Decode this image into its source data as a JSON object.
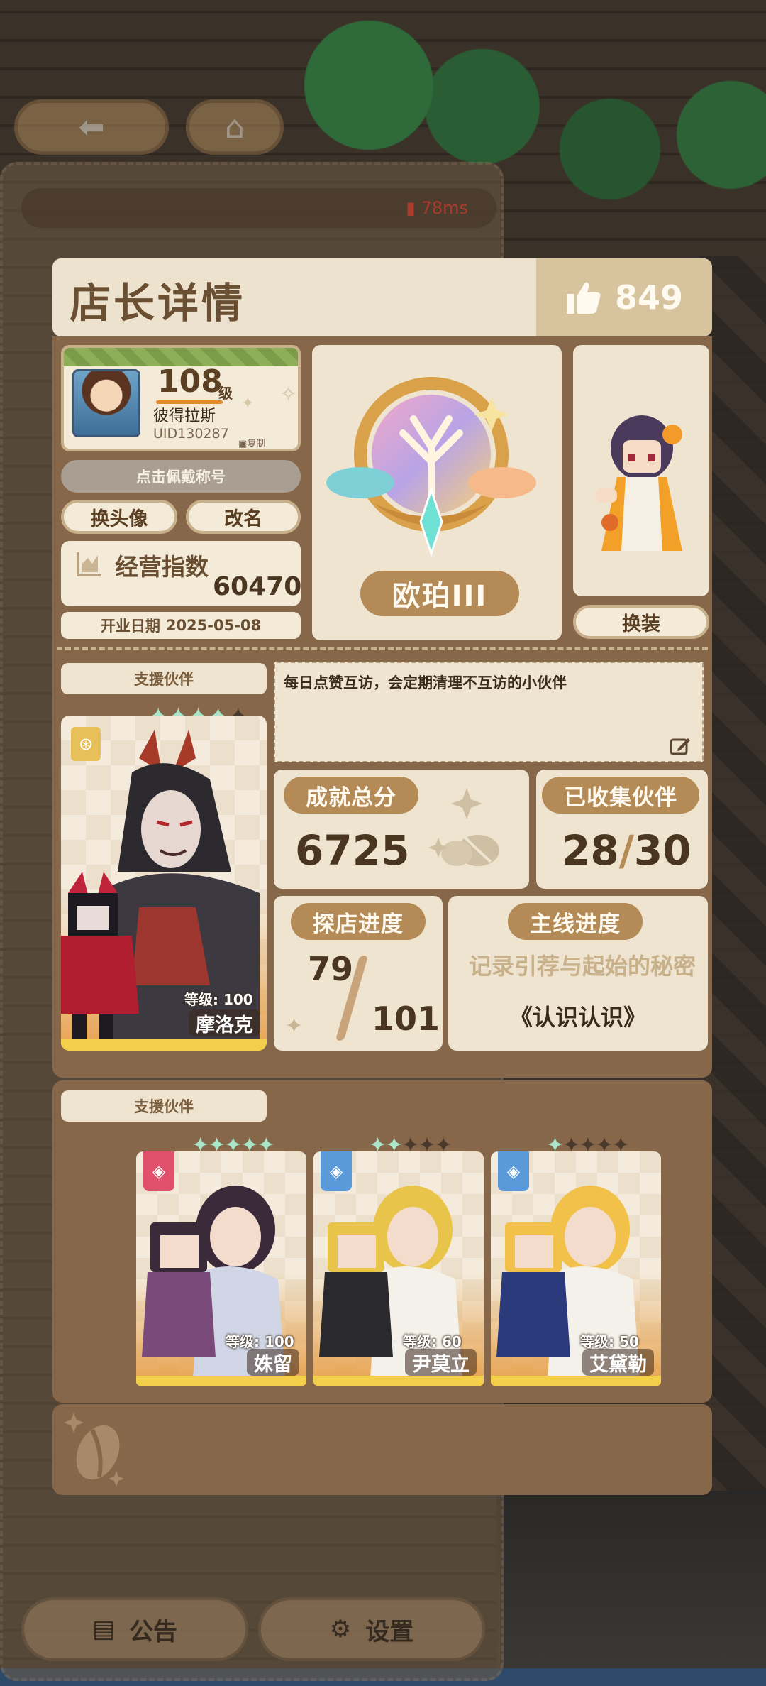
{
  "hud": {
    "back_icon": "arrow-left-icon",
    "home_icon": "home-icon",
    "ping": "78ms"
  },
  "bottom_bar": {
    "notice_label": "公告",
    "settings_label": "设置"
  },
  "modal": {
    "title": "店长详情",
    "likes": "849",
    "profile": {
      "level": "108",
      "level_unit": "级",
      "name": "彼得拉斯",
      "uid": "UID130287",
      "copy_label": "复制"
    },
    "wear_title_label": "点击佩戴称号",
    "change_avatar_label": "换头像",
    "rename_label": "改名",
    "business_index": {
      "label": "经营指数",
      "value": "60470"
    },
    "open_date": {
      "label": "开业日期",
      "value": "2025-05-08"
    },
    "badge_name": "欧珀III",
    "outfit_label": "换装",
    "support_partner": {
      "tag": "支援伙伴",
      "stars": 4,
      "level_text": "等级: 100",
      "name": "摩洛克"
    },
    "motto": "每日点赞互访，会定期清理不互访的小伙伴",
    "achievement": {
      "label": "成就总分",
      "value": "6725"
    },
    "collected": {
      "label": "已收集伙伴",
      "value": "28",
      "slash": "/",
      "total": "30"
    },
    "explore": {
      "label": "探店进度",
      "value": "79",
      "total": "101"
    },
    "main_quest": {
      "label": "主线进度",
      "chapter": "记录引荐与起始的秘密",
      "name": "《认识认识》"
    },
    "team": {
      "tag": "支援伙伴",
      "members": [
        {
          "level_text": "等级: 100",
          "name": "姝留",
          "stars": 5,
          "max_stars": 5,
          "role_color": "#e0506a"
        },
        {
          "level_text": "等级: 60",
          "name": "尹莫立",
          "stars": 2,
          "max_stars": 5,
          "role_color": "#5a9ad8"
        },
        {
          "level_text": "等级: 50",
          "name": "艾黛勒",
          "stars": 1,
          "max_stars": 5,
          "role_color": "#5a9ad8"
        }
      ]
    }
  },
  "colors": {
    "frame": "#87674a",
    "cream": "#efe4cf",
    "tag": "#b48a56",
    "gold_bar": "#f4cf4c"
  }
}
